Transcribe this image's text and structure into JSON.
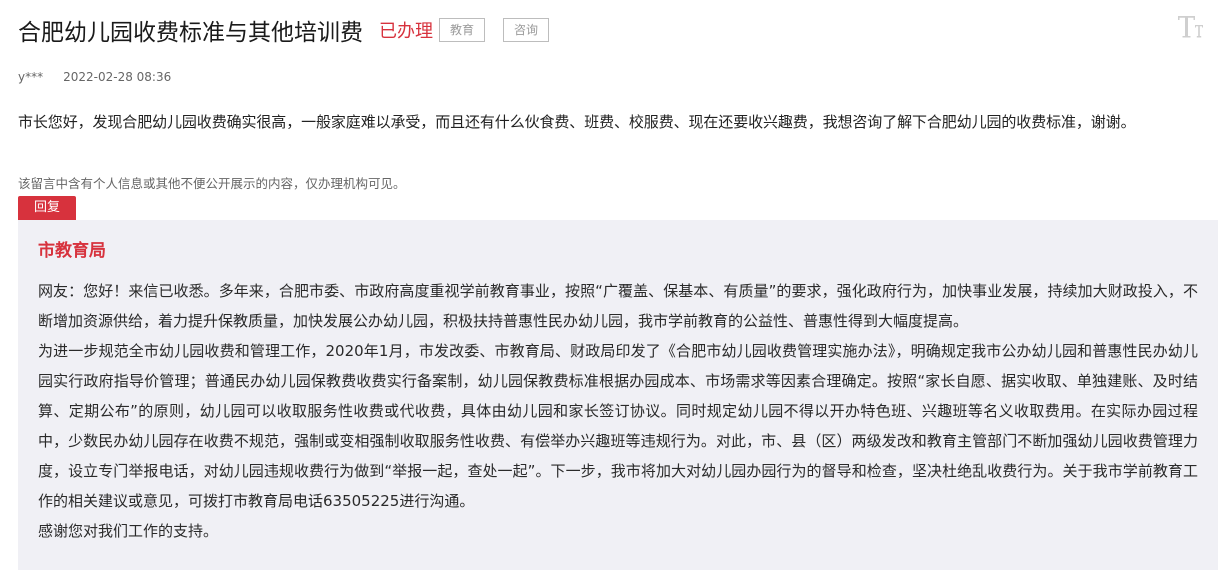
{
  "header": {
    "title": "合肥幼儿园收费标准与其他培训费",
    "status": "已办理",
    "tags": [
      "教育",
      "咨询"
    ],
    "font_size_icon": "font-size-icon"
  },
  "meta": {
    "author": "y***",
    "datetime": "2022-02-28 08:36"
  },
  "question": {
    "text": "市长您好，发现合肥幼儿园收费确实很高，一般家庭难以承受，而且还有什么伙食费、班费、校服费、现在还要收兴趣费，我想咨询了解下合肥幼儿园的收费标准，谢谢。"
  },
  "privacy_note": "该留言中含有个人信息或其他不便公开展示的内容，仅办理机构可见。",
  "reply": {
    "tab_label": "回复",
    "org": "市教育局",
    "paragraphs": [
      "网友：您好！来信已收悉。多年来，合肥市委、市政府高度重视学前教育事业，按照“广覆盖、保基本、有质量”的要求，强化政府行为，加快事业发展，持续加大财政投入，不断增加资源供给，着力提升保教质量，加快发展公办幼儿园，积极扶持普惠性民办幼儿园，我市学前教育的公益性、普惠性得到大幅度提高。",
      "为进一步规范全市幼儿园收费和管理工作，2020年1月，市发改委、市教育局、财政局印发了《合肥市幼儿园收费管理实施办法》，明确规定我市公办幼儿园和普惠性民办幼儿园实行政府指导价管理；普通民办幼儿园保教费收费实行备案制，幼儿园保教费标准根据办园成本、市场需求等因素合理确定。按照“家长自愿、据实收取、单独建账、及时结算、定期公布”的原则，幼儿园可以收取服务性收费或代收费，具体由幼儿园和家长签订协议。同时规定幼儿园不得以开办特色班、兴趣班等名义收取费用。在实际办园过程中，少数民办幼儿园存在收费不规范，强制或变相强制收取服务性收费、有偿举办兴趣班等违规行为。对此，市、县（区）两级发改和教育主管部门不断加强幼儿园收费管理力度，设立专门举报电话，对幼儿园违规收费行为做到“举报一起，查处一起”。下一步，我市将加大对幼儿园办园行为的督导和检查，坚决杜绝乱收费行为。关于我市学前教育工作的相关建议或意见，可拨打市教育局电话63505225进行沟通。",
      "感谢您对我们工作的支持。"
    ]
  },
  "colors": {
    "accent": "#d7323d",
    "reply_bg": "#f0f0f5"
  }
}
